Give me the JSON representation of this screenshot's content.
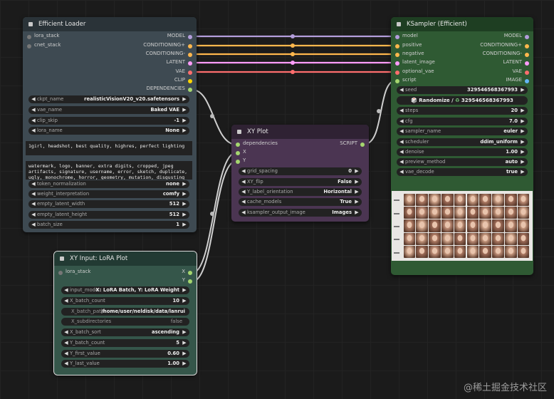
{
  "colors": {
    "canvas": "#1b1b1b",
    "loader_body": "#3e4a52",
    "loader_header": "#2a3338",
    "xyplot_body": "#4b3552",
    "xyplot_header": "#2f2233",
    "lora_body": "#35564a",
    "lora_header": "#223a33",
    "ksampler_body": "#2f5a33",
    "ksampler_header": "#1e3e22",
    "model_pin": "#b39ddb",
    "conditioning_pin": "#ffb74d",
    "latent_pin": "#ff9cf9",
    "vae_pin": "#ff6e6e",
    "clip_pin": "#ffd500",
    "dep_pin": "#a5d66f",
    "script_pin": "#a5d66f"
  },
  "efficient_loader": {
    "title": "Efficient Loader",
    "inputs": [
      "lora_stack",
      "cnet_stack"
    ],
    "outputs": [
      "MODEL",
      "CONDITIONING+",
      "CONDITIONING-",
      "LATENT",
      "VAE",
      "CLIP",
      "DEPENDENCIES"
    ],
    "widgets": [
      {
        "name": "ckpt_name",
        "value": "realisticVisionV20_v20.safetensors"
      },
      {
        "name": "vae_name",
        "value": "Baked VAE"
      },
      {
        "name": "clip_skip",
        "value": "-1"
      },
      {
        "name": "lora_name",
        "value": "None"
      }
    ],
    "positive": "1girl, headshot, best quality, highres, perfect lighting",
    "negative": "watermark, logo, banner, extra digits, cropped, jpeg artifacts, signature, username, error, sketch, duplicate, ugly, monochrome, horror, geometry, mutation, disgusting",
    "widgets2": [
      {
        "name": "token_normalization",
        "value": "none"
      },
      {
        "name": "weight_interpretation",
        "value": "comfy"
      },
      {
        "name": "empty_latent_width",
        "value": "512"
      },
      {
        "name": "empty_latent_height",
        "value": "512"
      },
      {
        "name": "batch_size",
        "value": "1"
      }
    ]
  },
  "xy_plot": {
    "title": "XY Plot",
    "inputs": [
      "dependencies",
      "X",
      "Y"
    ],
    "output": "SCRIPT",
    "widgets": [
      {
        "name": "grid_spacing",
        "value": "0"
      },
      {
        "name": "XY_flip",
        "value": "False"
      },
      {
        "name": "Y_label_orientation",
        "value": "Horizontal"
      },
      {
        "name": "cache_models",
        "value": "True"
      },
      {
        "name": "ksampler_output_image",
        "value": "Images"
      }
    ]
  },
  "lora_plot": {
    "title": "XY Input: LoRA Plot",
    "input": "lora_stack",
    "outputs": [
      "X",
      "Y"
    ],
    "widgets": [
      {
        "name": "input_mode",
        "value": "X: LoRA Batch, Y: LoRA Weight",
        "kind": "arrows"
      },
      {
        "name": "X_batch_count",
        "value": "10",
        "kind": "arrows"
      },
      {
        "name": "X_batch_path",
        "value": "/home/user/neldisk/data/lanrui",
        "kind": "plain"
      },
      {
        "name": "X_subdirectories",
        "value": "false",
        "kind": "plain"
      },
      {
        "name": "X_batch_sort",
        "value": "ascending",
        "kind": "arrows"
      },
      {
        "name": "Y_batch_count",
        "value": "5",
        "kind": "arrows"
      },
      {
        "name": "Y_first_value",
        "value": "0.60",
        "kind": "arrows"
      },
      {
        "name": "Y_last_value",
        "value": "1.00",
        "kind": "arrows"
      }
    ]
  },
  "ksampler": {
    "title": "KSampler (Efficient)",
    "inputs": [
      "model",
      "positive",
      "negative",
      "latent_image",
      "optional_vae",
      "script"
    ],
    "outputs": [
      "MODEL",
      "CONDITIONING+",
      "CONDITIONING-",
      "LATENT",
      "VAE",
      "IMAGE"
    ],
    "seed": {
      "name": "seed",
      "value": "329546568367993"
    },
    "randomize_label": "Randomize /",
    "randomize_value": "329546568367993",
    "widgets": [
      {
        "name": "steps",
        "value": "20"
      },
      {
        "name": "cfg",
        "value": "7.0"
      },
      {
        "name": "sampler_name",
        "value": "euler"
      },
      {
        "name": "scheduler",
        "value": "ddim_uniform"
      },
      {
        "name": "denoise",
        "value": "1.00"
      },
      {
        "name": "preview_method",
        "value": "auto"
      },
      {
        "name": "vae_decode",
        "value": "true"
      }
    ]
  },
  "watermark": "@稀土掘金技术社区"
}
